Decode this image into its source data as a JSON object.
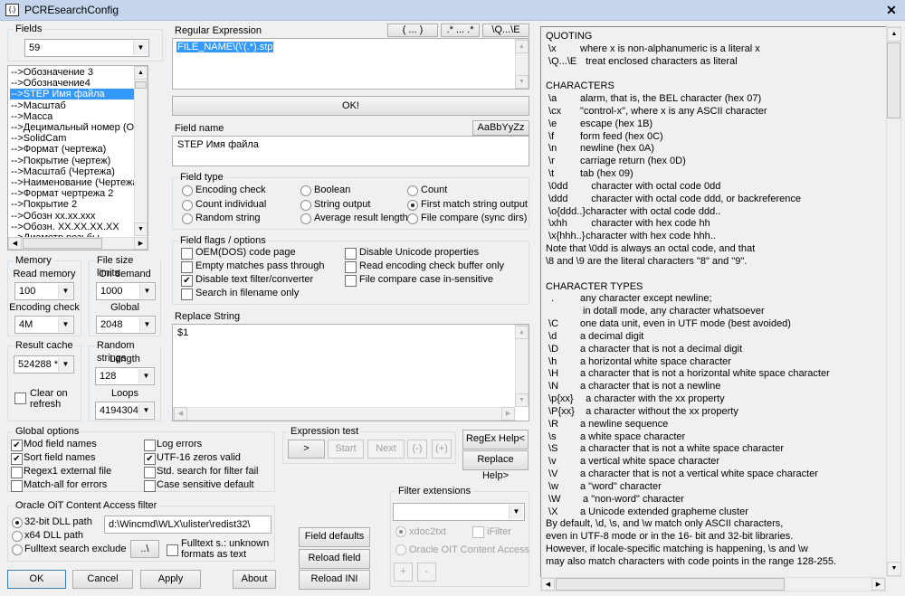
{
  "window": {
    "title": "PCREsearchConfig",
    "icon": "regex-app-icon",
    "close": "✕"
  },
  "fields": {
    "label": "Fields",
    "value": "59",
    "items": [
      "-->Обозначение 3",
      "-->Обозначение4",
      "-->STEP Имя файла",
      "-->Масштаб",
      "-->Масса",
      "-->Децимальный номер (Обозначение)",
      "-->SolidCam",
      "-->Формат (чертежа)",
      "-->Покрытие (чертеж)",
      "-->Масштаб (Чертежа)",
      "-->Наименование (Чертежа)",
      "-->Формат чертрежа 2",
      "-->Покрытие 2",
      "-->Обозн xx.xx.xxx",
      "-->Обозн. XX.XX.XX.XX",
      "-->Диаметр резьбы"
    ],
    "selected_index": 2
  },
  "memory": {
    "label": "Memory",
    "read_label": "Read memory",
    "read_value": "100",
    "enc_label": "Encoding check",
    "enc_value": "4M"
  },
  "filesize": {
    "label": "File size limits",
    "ondemand_label": "On demand",
    "ondemand_value": "1000",
    "global_label": "Global",
    "global_value": "2048"
  },
  "cache": {
    "label": "Result cache",
    "value": "524288 *",
    "clear_line1": "Clear on",
    "clear_line2": "refresh",
    "clear_checked": false
  },
  "random": {
    "label": "Random strings",
    "length_label": "Length",
    "length_value": "128",
    "loops_label": "Loops",
    "loops_value": "4194304"
  },
  "global_options": {
    "label": "Global options",
    "items": [
      {
        "label": "Mod field names",
        "checked": true
      },
      {
        "label": "Log errors",
        "checked": false
      },
      {
        "label": "Sort field names",
        "checked": true
      },
      {
        "label": "UTF-16 zeros valid",
        "checked": true
      },
      {
        "label": "Regex1 external file",
        "checked": false
      },
      {
        "label": "Std. search for filter fail",
        "checked": false
      },
      {
        "label": "Match-all for errors",
        "checked": false
      },
      {
        "label": "Case sensitive default",
        "checked": false
      }
    ]
  },
  "oracle": {
    "label": "Oracle OiT Content Access filter",
    "r32": "32-bit DLL path",
    "r64": "x64 DLL path",
    "rfull": "Fulltext search exclude",
    "selected": "32-bit DLL path",
    "path": "d:\\Wincmd\\WLX\\ulister\\redist32\\",
    "browse": "..\\",
    "fulltext_line1": "Fulltext s.: unknown",
    "fulltext_line2": "formats as text",
    "fulltext_checked": false
  },
  "buttons": {
    "ok": "OK",
    "cancel": "Cancel",
    "apply": "Apply",
    "about": "About",
    "field_defaults": "Field defaults",
    "reload_field": "Reload field",
    "reload_ini": "Reload INI",
    "regex_help": "RegEx Help<",
    "replace_help": "Replace Help>"
  },
  "regex": {
    "label": "Regular Expression",
    "btn_group": "( ... )",
    "btn_any": ".* ... .*",
    "btn_quote": "\\Q...\\E",
    "value": "FILE_NAME\\(\\'(.*).stp",
    "ok": "OK!"
  },
  "field_name": {
    "label": "Field name",
    "case_btn": "AaBbYyZz",
    "value": "STEP Имя файла"
  },
  "field_type": {
    "label": "Field type",
    "options": [
      "Encoding check",
      "Boolean",
      "Count",
      "Count individual",
      "String output",
      "First match string output",
      "Random string",
      "Average result length",
      "File compare (sync dirs)"
    ],
    "selected": "First match string output"
  },
  "field_flags": {
    "label": "Field flags / options",
    "items": [
      {
        "label": "OEM(DOS) code page",
        "checked": false
      },
      {
        "label": "Disable Unicode properties",
        "checked": false
      },
      {
        "label": "Empty matches pass through",
        "checked": false
      },
      {
        "label": "Read encoding check buffer only",
        "checked": false
      },
      {
        "label": "Disable text filter/converter",
        "checked": true
      },
      {
        "label": "File compare case in-sensitive",
        "checked": false
      },
      {
        "label": "Search in filename only",
        "checked": false
      }
    ]
  },
  "replace": {
    "label": "Replace String",
    "value": "$1"
  },
  "expr_test": {
    "label": "Expression test",
    "run": ">",
    "start": "Start",
    "next": "Next",
    "minus": "(-)",
    "plus": "(+)"
  },
  "filter_ext": {
    "label": "Filter extensions",
    "value": "",
    "xdoc": "xdoc2txt",
    "ifilter": "iFilter",
    "oracle": "Oracle OIT Content Access",
    "add": "+",
    "remove": "-"
  },
  "help": {
    "lines": [
      {
        "k": "QUOTING",
        "d": ""
      },
      {
        "k": " \\x",
        "d": "where x is non-alphanumeric is a literal x"
      },
      {
        "k": " \\Q...\\E",
        "d": "  treat enclosed characters as literal"
      },
      {
        "k": "",
        "d": ""
      },
      {
        "k": "CHARACTERS",
        "d": ""
      },
      {
        "k": " \\a",
        "d": "alarm, that is, the BEL character (hex 07)"
      },
      {
        "k": " \\cx",
        "d": "\"control-x\", where x is any ASCII character"
      },
      {
        "k": " \\e",
        "d": "escape (hex 1B)"
      },
      {
        "k": " \\f",
        "d": "form feed (hex 0C)"
      },
      {
        "k": " \\n",
        "d": "newline (hex 0A)"
      },
      {
        "k": " \\r",
        "d": "carriage return (hex 0D)"
      },
      {
        "k": " \\t",
        "d": "tab (hex 09)"
      },
      {
        "k": " \\0dd",
        "d": "    character with octal code 0dd"
      },
      {
        "k": " \\ddd",
        "d": "    character with octal code ddd, or backreference"
      },
      {
        "k": " \\o{ddd..}",
        "d": "  character with octal code ddd.."
      },
      {
        "k": " \\xhh",
        "d": "    character with hex code hh"
      },
      {
        "k": " \\x{hhh..}",
        "d": "  character with hex code hhh.."
      },
      {
        "k": "Note that \\0dd is always an octal code, and that",
        "d": ""
      },
      {
        "k": "\\8 and \\9 are the literal characters \"8\" and \"9\".",
        "d": ""
      },
      {
        "k": "",
        "d": ""
      },
      {
        "k": "CHARACTER TYPES",
        "d": ""
      },
      {
        "k": "  .",
        "d": "any character except newline;"
      },
      {
        "k": "",
        "d": " in dotall mode, any character whatsoever"
      },
      {
        "k": " \\C",
        "d": "one data unit, even in UTF mode (best avoided)"
      },
      {
        "k": " \\d",
        "d": "a decimal digit"
      },
      {
        "k": " \\D",
        "d": "a character that is not a decimal digit"
      },
      {
        "k": " \\h",
        "d": "a horizontal white space character"
      },
      {
        "k": " \\H",
        "d": "a character that is not a horizontal white space character"
      },
      {
        "k": " \\N",
        "d": "a character that is not a newline"
      },
      {
        "k": " \\p{xx}",
        "d": "  a character with the xx property"
      },
      {
        "k": " \\P{xx}",
        "d": "  a character without the xx property"
      },
      {
        "k": " \\R",
        "d": "a newline sequence"
      },
      {
        "k": " \\s",
        "d": "a white space character"
      },
      {
        "k": " \\S",
        "d": "a character that is not a white space character"
      },
      {
        "k": " \\v",
        "d": "a vertical white space character"
      },
      {
        "k": " \\V",
        "d": "a character that is not a vertical white space character"
      },
      {
        "k": " \\w",
        "d": "a \"word\" character"
      },
      {
        "k": " \\W",
        "d": " a \"non-word\" character"
      },
      {
        "k": " \\X",
        "d": "a Unicode extended grapheme cluster"
      },
      {
        "k": "By default, \\d, \\s, and \\w match only ASCII characters,",
        "d": ""
      },
      {
        "k": "even in UTF-8 mode or in the 16- bit and 32-bit libraries.",
        "d": ""
      },
      {
        "k": "However, if locale-specific matching is happening, \\s and \\w",
        "d": ""
      },
      {
        "k": "may also match characters with code points in the range 128-255.",
        "d": ""
      }
    ]
  },
  "colors": {
    "selection": "#3399ff",
    "titlebar": "#c5d6ec",
    "face": "#f0f0f0"
  }
}
